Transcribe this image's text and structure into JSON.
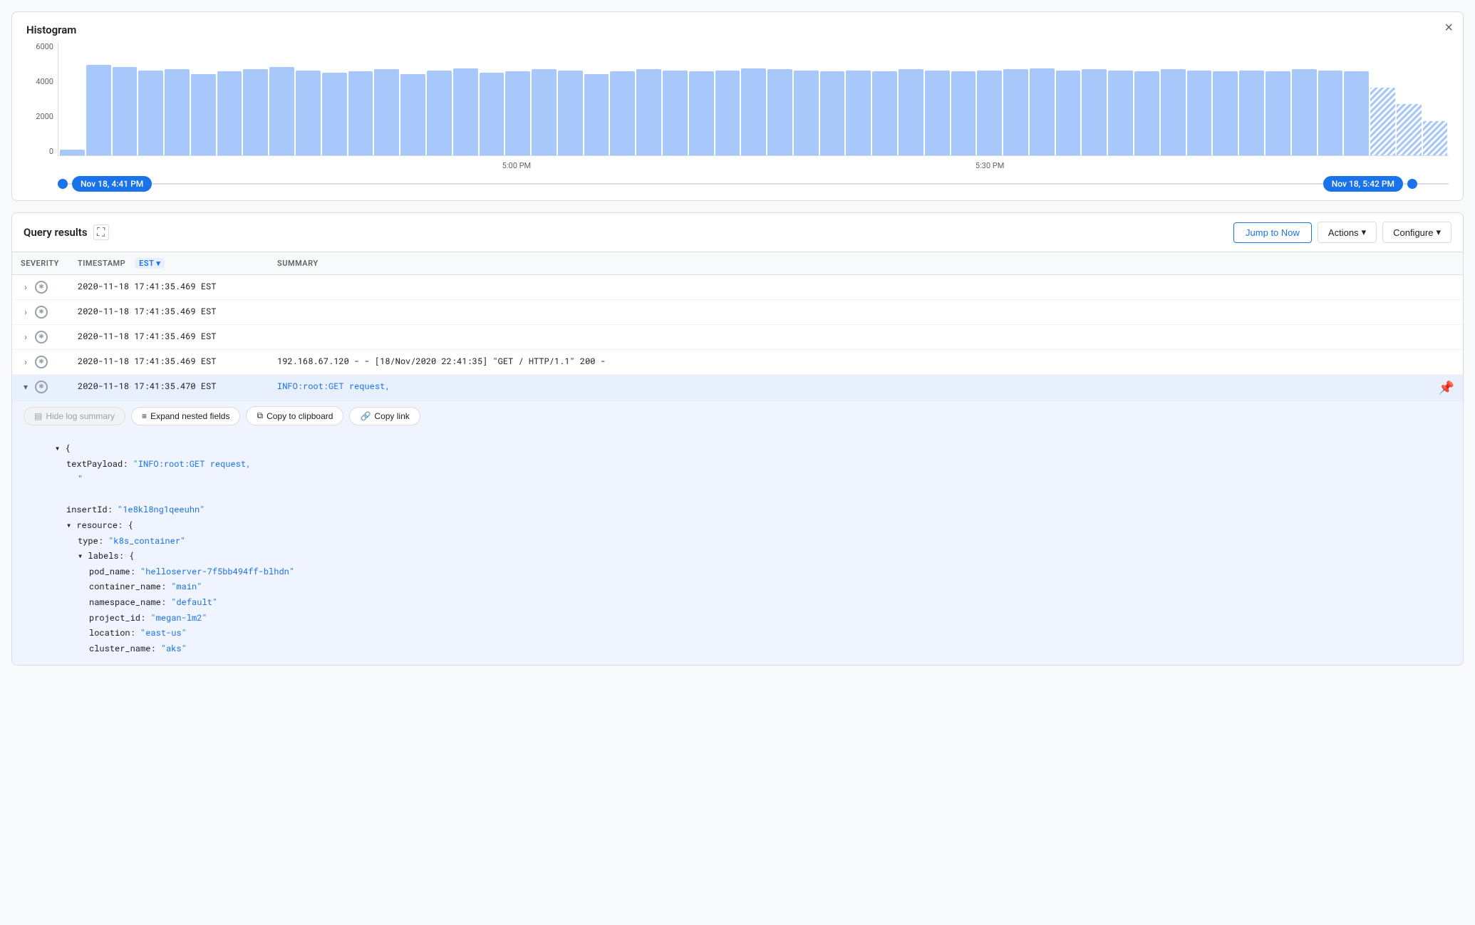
{
  "histogram": {
    "title": "Histogram",
    "close_label": "×",
    "y_axis": [
      "6000",
      "4000",
      "2000",
      "0"
    ],
    "x_axis": [
      "Nov 18, 4:41 PM",
      "5:00 PM",
      "5:30 PM",
      "Nov 18, 5:42 PM"
    ],
    "range_start": "Nov 18, 4:41 PM",
    "range_end": "Nov 18, 5:42 PM",
    "bars": [
      5,
      80,
      78,
      75,
      76,
      72,
      74,
      76,
      78,
      75,
      73,
      74,
      76,
      72,
      75,
      77,
      73,
      74,
      76,
      75,
      72,
      74,
      76,
      75,
      74,
      75,
      77,
      76,
      75,
      74,
      75,
      74,
      76,
      75,
      74,
      75,
      76,
      77,
      75,
      76,
      75,
      74,
      76,
      75,
      74,
      75,
      74,
      76,
      75,
      74,
      60,
      45,
      30
    ]
  },
  "query_results": {
    "title": "Query results",
    "expand_icon": "⛶",
    "jump_to_now": "Jump to Now",
    "actions_label": "Actions",
    "configure_label": "Configure",
    "columns": {
      "severity": "SEVERITY",
      "timestamp": "TIMESTAMP",
      "timezone": "EST",
      "summary": "SUMMARY"
    },
    "rows": [
      {
        "id": 1,
        "expanded": false,
        "timestamp": "2020-11-18 17:41:35.469 EST",
        "summary": ""
      },
      {
        "id": 2,
        "expanded": false,
        "timestamp": "2020-11-18 17:41:35.469 EST",
        "summary": ""
      },
      {
        "id": 3,
        "expanded": false,
        "timestamp": "2020-11-18 17:41:35.469 EST",
        "summary": ""
      },
      {
        "id": 4,
        "expanded": false,
        "timestamp": "2020-11-18 17:41:35.469 EST",
        "summary": "192.168.67.120 - - [18/Nov/2020 22:41:35] \"GET / HTTP/1.1\" 200 -"
      },
      {
        "id": 5,
        "expanded": true,
        "timestamp": "2020-11-18 17:41:35.470 EST",
        "summary": "INFO:root:GET request,"
      }
    ],
    "expanded_detail": {
      "hide_log_summary": "Hide log summary",
      "expand_nested": "Expand nested fields",
      "copy_clipboard": "Copy to clipboard",
      "copy_link": "Copy link",
      "content": {
        "text_payload_key": "textPayload:",
        "text_payload_val": "\"INFO:root:GET request,",
        "text_payload_val2": "\"",
        "insert_id_key": "insertId:",
        "insert_id_val": "\"1e8kl8ng1qeeuhn\"",
        "resource_key": "resource: {",
        "type_key": "type:",
        "type_val": "\"k8s_container\"",
        "labels_key": "labels: {",
        "pod_name_key": "pod_name:",
        "pod_name_val": "\"helloserver-7f5bb494ff-blhdn\"",
        "container_name_key": "container_name:",
        "container_name_val": "\"main\"",
        "namespace_name_key": "namespace_name:",
        "namespace_name_val": "\"default\"",
        "project_id_key": "project_id:",
        "project_id_val": "\"megan-lm2\"",
        "location_key": "location:",
        "location_val": "\"east-us\"",
        "cluster_name_key": "cluster_name:",
        "cluster_name_val": "\"aks\""
      }
    }
  }
}
